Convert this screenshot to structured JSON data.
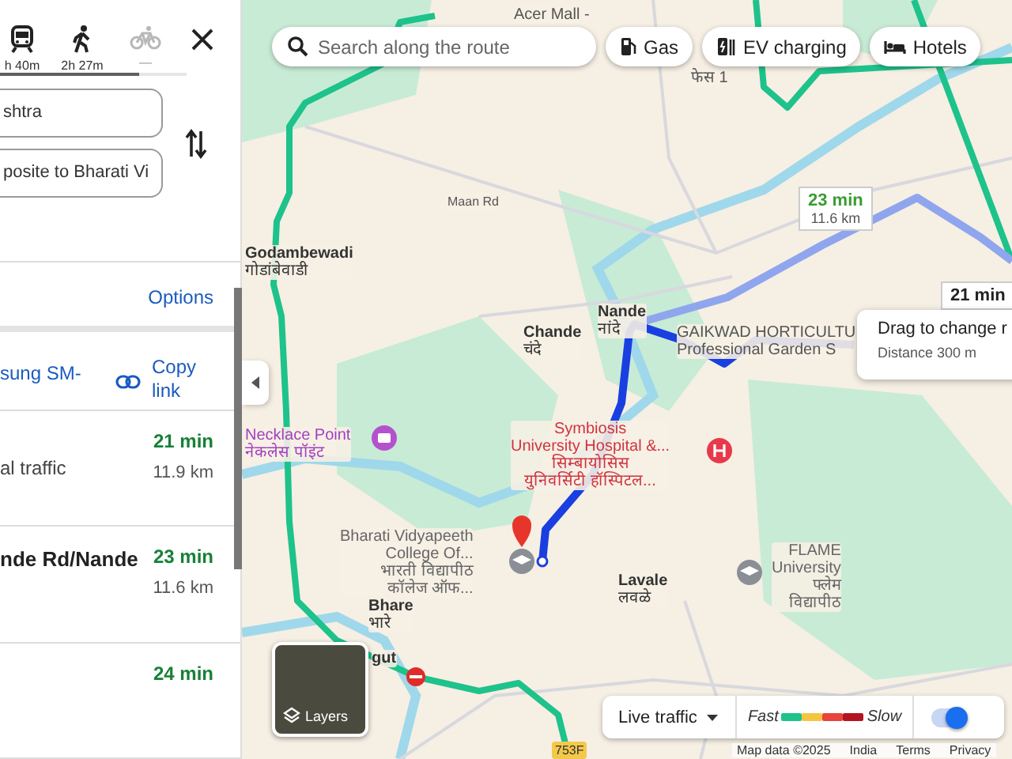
{
  "panel": {
    "modes": [
      {
        "kind": "transit",
        "time": "h 40m",
        "disabled": false
      },
      {
        "kind": "walk",
        "time": "2h 27m",
        "disabled": false
      },
      {
        "kind": "bike",
        "time": "—",
        "disabled": true
      }
    ],
    "origin": {
      "value": "shtra"
    },
    "destination": {
      "value": "posite to Bharati Vi"
    },
    "options": "Options",
    "share": {
      "text": "sung SM-",
      "link": "Copy link"
    },
    "routes": [
      {
        "subtitle": "al traffic",
        "time": "21 min",
        "distance": "11.9 km"
      },
      {
        "title": "nde Rd/Nande",
        "time": "23 min",
        "distance": "11.6 km"
      },
      {
        "time": "24 min"
      }
    ]
  },
  "map": {
    "search": {
      "placeholder": "Search along the route"
    },
    "chips": [
      {
        "kind": "gas",
        "label": "Gas"
      },
      {
        "kind": "ev",
        "label": "EV charging"
      },
      {
        "kind": "hotel",
        "label": "Hotels"
      }
    ],
    "labels": [
      {
        "kind": "area",
        "lines": [
          "Acer Mall -"
        ]
      },
      {
        "kind": "area",
        "lines": [
          "फेस 1"
        ]
      },
      {
        "kind": "road",
        "lines": [
          "Maan Rd"
        ]
      },
      {
        "kind": "place",
        "lines": [
          "Godambewadi",
          "गोडांबेवाडी"
        ]
      },
      {
        "kind": "place",
        "lines": [
          "Chande",
          "चंदे"
        ]
      },
      {
        "kind": "place",
        "lines": [
          "Nande",
          "नांदे"
        ]
      },
      {
        "kind": "area",
        "lines": [
          "GAIKWAD HORTICULTU",
          "Professional Garden S"
        ]
      },
      {
        "kind": "attraction",
        "lines": [
          "Necklace Point",
          "नेकलेस पॉइंट"
        ]
      },
      {
        "kind": "hospital",
        "lines": [
          "Symbiosis",
          "University Hospital &...",
          "सिम्बायोसिस",
          "युनिवर्सिटी हॉस्पिटल..."
        ]
      },
      {
        "kind": "school",
        "lines": [
          "Bharati Vidyapeeth",
          "College Of...",
          "भारती विद्यापीठ",
          "कॉलेज ऑफ..."
        ]
      },
      {
        "kind": "place",
        "lines": [
          "Lavale",
          "लवळे"
        ]
      },
      {
        "kind": "school",
        "lines": [
          "FLAME",
          "University",
          "फ्लेम",
          "विद्यापीठ"
        ]
      },
      {
        "kind": "place",
        "lines": [
          "Bhare",
          "भारे"
        ]
      },
      {
        "kind": "place",
        "lines": [
          "gut"
        ]
      },
      {
        "kind": "shield",
        "lines": [
          "753F"
        ]
      }
    ],
    "callouts": [
      {
        "time": "23 min",
        "distance": "11.6 km"
      },
      {
        "time": "21 min"
      }
    ],
    "tooltip": {
      "title": "Drag to change r",
      "detail": "Distance 300 m"
    },
    "layers": "Layers",
    "legend": {
      "label": "Live traffic",
      "fast": "Fast",
      "slow": "Slow",
      "scale": [
        {
          "color": "#1ec28b"
        },
        {
          "color": "#f5c542"
        },
        {
          "color": "#e8453c"
        },
        {
          "color": "#b3141f"
        }
      ],
      "on": true
    },
    "footer": [
      "Map data ©2025",
      "India",
      "Terms",
      "Privacy"
    ]
  }
}
